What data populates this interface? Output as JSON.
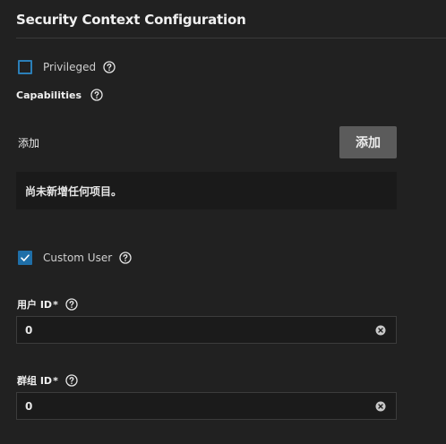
{
  "section": {
    "title": "Security Context Configuration"
  },
  "privileged": {
    "label": "Privileged",
    "checked": false
  },
  "capabilities": {
    "label": "Capabilities",
    "add_text": "添加",
    "add_button_label": "添加",
    "empty_message": "尚未新增任何项目。"
  },
  "custom_user": {
    "label": "Custom User",
    "checked": true
  },
  "user_id": {
    "label": "用户 ID",
    "required_mark": "*",
    "value": "0"
  },
  "group_id": {
    "label": "群组 ID",
    "required_mark": "*",
    "value": "0"
  },
  "colors": {
    "background": "#212121",
    "accent": "#1f6fa8",
    "button": "#5b5b5b"
  },
  "icons": {
    "help": "help-circle-icon",
    "clear": "clear-circle-icon",
    "check": "check-icon"
  }
}
